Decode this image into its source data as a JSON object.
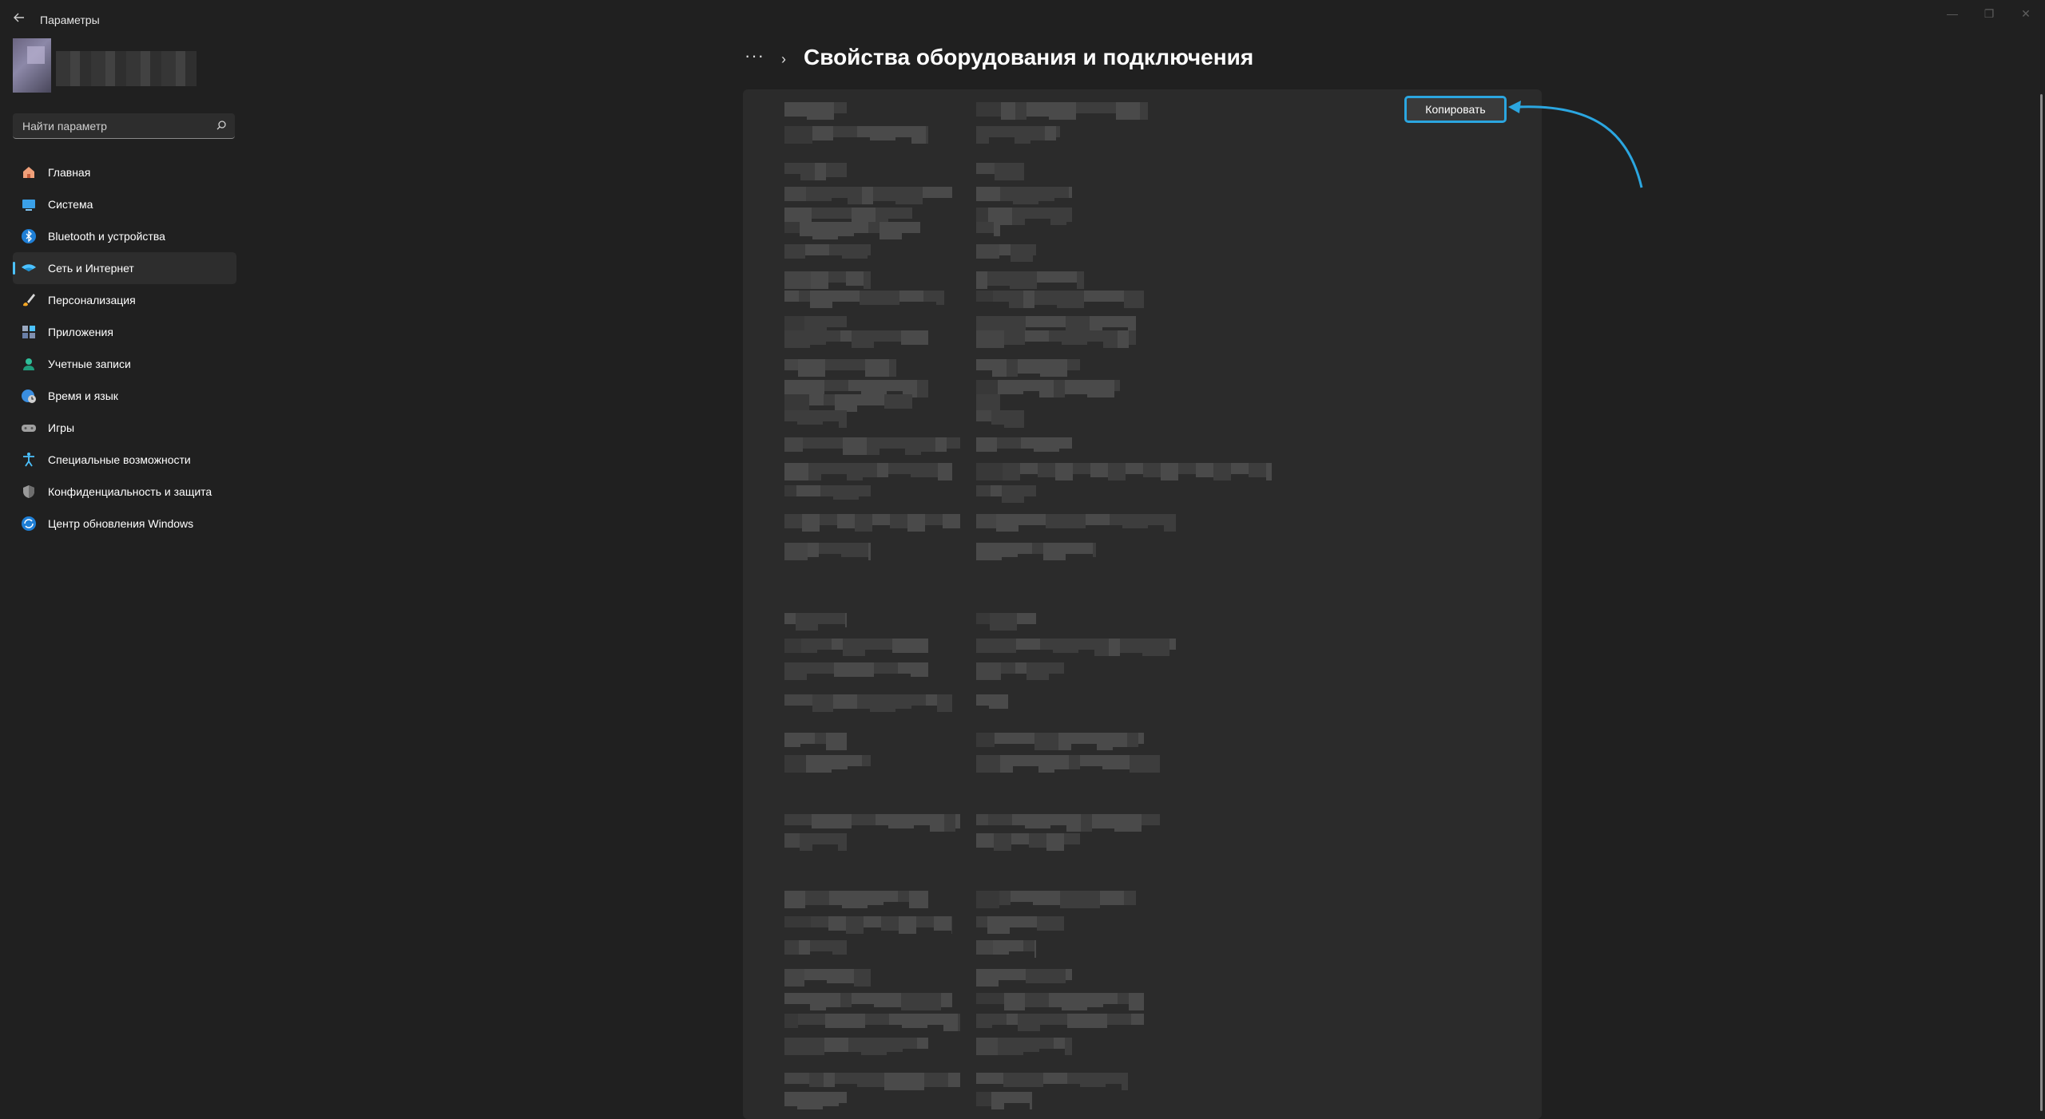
{
  "window": {
    "title": "Параметры",
    "controls": {
      "minimize": "—",
      "maximize": "❐",
      "close": "✕"
    }
  },
  "search": {
    "placeholder": "Найти параметр"
  },
  "nav": {
    "items": [
      {
        "label": "Главная",
        "icon": "home-icon",
        "active": false
      },
      {
        "label": "Система",
        "icon": "system-icon",
        "active": false
      },
      {
        "label": "Bluetooth и устройства",
        "icon": "bluetooth-icon",
        "active": false
      },
      {
        "label": "Сеть и Интернет",
        "icon": "network-icon",
        "active": true
      },
      {
        "label": "Персонализация",
        "icon": "brush-icon",
        "active": false
      },
      {
        "label": "Приложения",
        "icon": "apps-icon",
        "active": false
      },
      {
        "label": "Учетные записи",
        "icon": "account-icon",
        "active": false
      },
      {
        "label": "Время и язык",
        "icon": "globe-clock-icon",
        "active": false
      },
      {
        "label": "Игры",
        "icon": "gamepad-icon",
        "active": false
      },
      {
        "label": "Специальные возможности",
        "icon": "accessibility-icon",
        "active": false
      },
      {
        "label": "Конфиденциальность и защита",
        "icon": "shield-icon",
        "active": false
      },
      {
        "label": "Центр обновления Windows",
        "icon": "update-icon",
        "active": false
      }
    ]
  },
  "header": {
    "more": "···",
    "chevron": "›",
    "title": "Свойства оборудования и подключения"
  },
  "actions": {
    "copy_label": "Копировать"
  },
  "colors": {
    "accent": "#4cc2ff",
    "highlight": "#2ba6e0",
    "background": "#202020",
    "panel": "#2b2b2b"
  }
}
